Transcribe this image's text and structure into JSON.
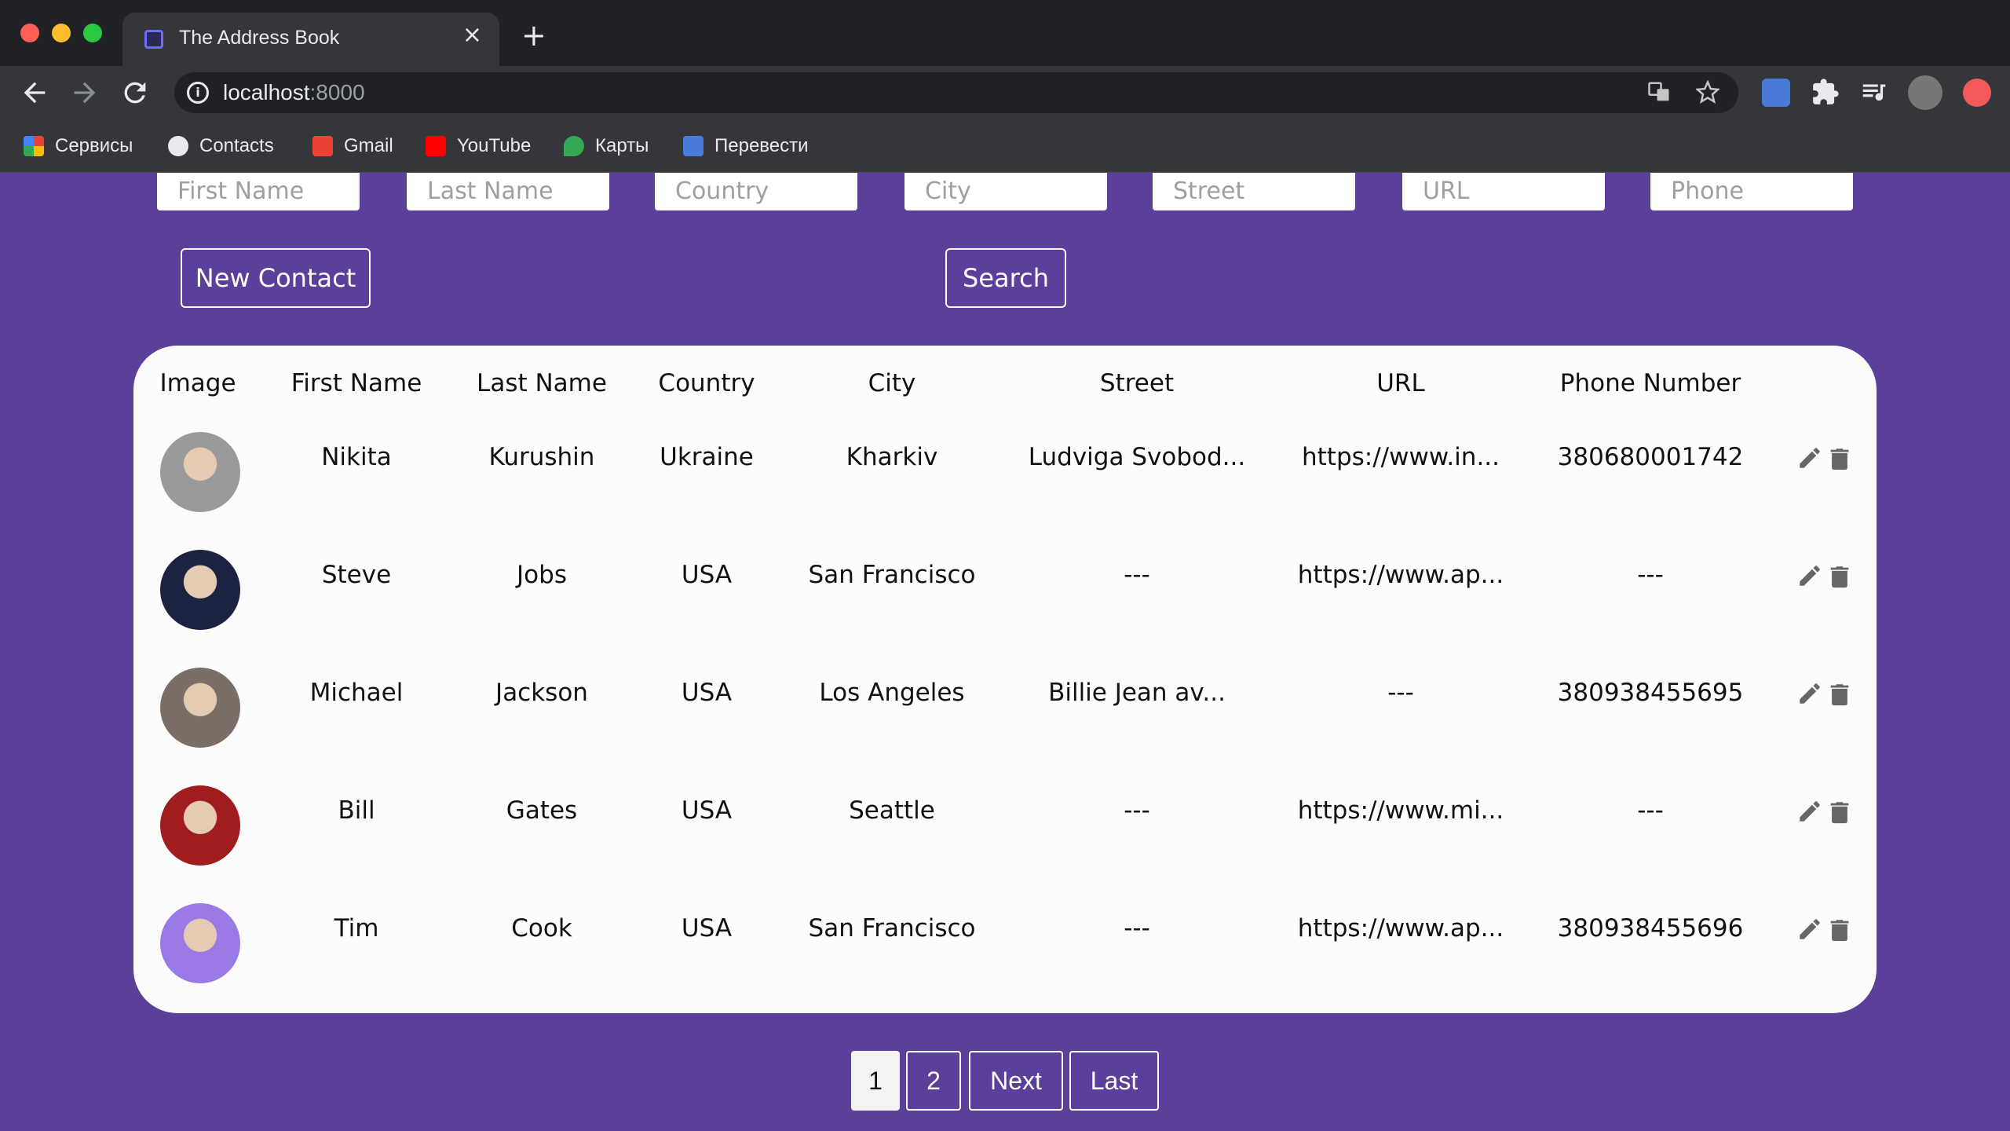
{
  "browser": {
    "tab_title": "The Address Book",
    "tab_close": "×",
    "new_tab": "+",
    "url_host": "localhost",
    "url_port": ":8000",
    "bookmarks": [
      {
        "label": "Сервисы",
        "icon": "apps-grid-icon"
      },
      {
        "label": "Contacts",
        "icon": "globe-icon"
      },
      {
        "label": "Gmail",
        "icon": "gmail-icon"
      },
      {
        "label": "YouTube",
        "icon": "youtube-icon"
      },
      {
        "label": "Карты",
        "icon": "maps-icon"
      },
      {
        "label": "Перевести",
        "icon": "translate-icon"
      }
    ]
  },
  "search_fields": {
    "first_name": "First Name",
    "last_name": "Last Name",
    "country": "Country",
    "city": "City",
    "street": "Street",
    "url": "URL",
    "phone": "Phone"
  },
  "buttons": {
    "new_contact": "New Contact",
    "search": "Search"
  },
  "table": {
    "headers": [
      "Image",
      "First Name",
      "Last Name",
      "Country",
      "City",
      "Street",
      "URL",
      "Phone Number"
    ],
    "rows": [
      {
        "first": "Nikita",
        "last": "Kurushin",
        "country": "Ukraine",
        "city": "Kharkiv",
        "street": "Ludviga Svobod...",
        "url": "https://www.in...",
        "phone": "380680001742",
        "avatar_color": "#9a9a9a"
      },
      {
        "first": "Steve",
        "last": "Jobs",
        "country": "USA",
        "city": "San Francisco",
        "street": "---",
        "url": "https://www.ap...",
        "phone": "---",
        "avatar_color": "#1c2340"
      },
      {
        "first": "Michael",
        "last": "Jackson",
        "country": "USA",
        "city": "Los Angeles",
        "street": "Billie Jean av...",
        "url": "---",
        "phone": "380938455695",
        "avatar_color": "#7a6e66"
      },
      {
        "first": "Bill",
        "last": "Gates",
        "country": "USA",
        "city": "Seattle",
        "street": "---",
        "url": "https://www.mi...",
        "phone": "---",
        "avatar_color": "#a11c1c"
      },
      {
        "first": "Tim",
        "last": "Cook",
        "country": "USA",
        "city": "San Francisco",
        "street": "---",
        "url": "https://www.ap...",
        "phone": "380938455696",
        "avatar_color": "#9b7ae6"
      }
    ]
  },
  "pagination": {
    "pages": [
      "1",
      "2"
    ],
    "next": "Next",
    "last": "Last",
    "current": "1"
  },
  "colors": {
    "page_bg": "#5b3f9a",
    "card_bg": "#fcfcfd",
    "icon_gray": "#666666"
  }
}
